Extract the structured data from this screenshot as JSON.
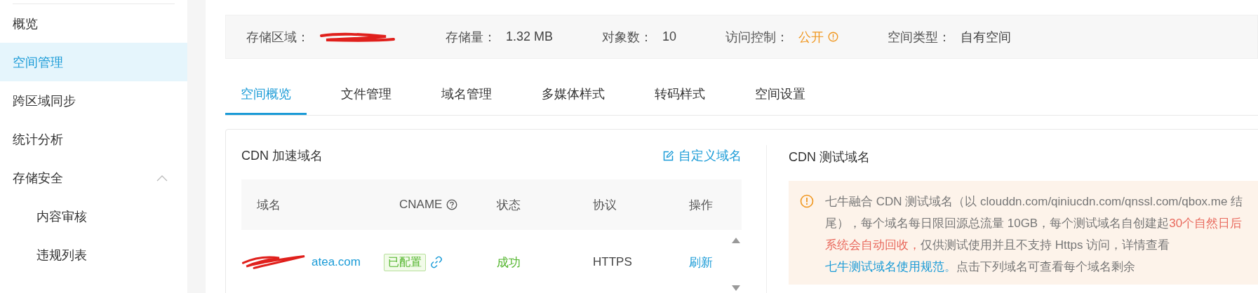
{
  "sidebar": {
    "items": [
      {
        "label": "概览",
        "selected": false
      },
      {
        "label": "空间管理",
        "selected": true
      },
      {
        "label": "跨区域同步",
        "selected": false
      },
      {
        "label": "统计分析",
        "selected": false
      },
      {
        "label": "存储安全",
        "selected": false,
        "expanded": true,
        "children": [
          {
            "label": "内容审核",
            "selected": false
          },
          {
            "label": "违规列表",
            "selected": false
          }
        ]
      }
    ]
  },
  "info_bar": [
    {
      "label": "存储区域：",
      "kind": "redacted"
    },
    {
      "label": "存储量：",
      "value": "1.32 MB",
      "kind": "plain"
    },
    {
      "label": "对象数：",
      "value": "10",
      "kind": "plain"
    },
    {
      "label": "访问控制：",
      "value": "公开",
      "kind": "warning"
    },
    {
      "label": "空间类型：",
      "value": "自有空间",
      "kind": "plain"
    }
  ],
  "tabs": [
    {
      "label": "空间概览",
      "selected": true
    },
    {
      "label": "文件管理",
      "selected": false
    },
    {
      "label": "域名管理",
      "selected": false
    },
    {
      "label": "多媒体样式",
      "selected": false
    },
    {
      "label": "转码样式",
      "selected": false
    },
    {
      "label": "空间设置",
      "selected": false
    }
  ],
  "cdn_domains": {
    "title": "CDN 加速域名",
    "action": "自定义域名",
    "table": {
      "columns": [
        {
          "label": "域名",
          "help": false
        },
        {
          "label": "CNAME",
          "help": true
        },
        {
          "label": "状态",
          "help": false
        },
        {
          "label": "协议",
          "help": false
        },
        {
          "label": "操作",
          "help": false
        }
      ],
      "rows": [
        {
          "domain": "atea.com",
          "redacted": true,
          "cname": "已配置",
          "status": "成功",
          "protocol": "HTTPS",
          "action": "刷新"
        }
      ]
    }
  },
  "test_domains": {
    "title": "CDN 测试域名",
    "notice": [
      {
        "text": "七牛融合 CDN 测试域名（以 clouddn.com/qiniucdn.com/qnssl.com/qbox.me 结尾），每个域名每日限回源总流量 10GB，每个测试域名自创建起",
        "kind": "plain"
      },
      {
        "text": "30个自然日后系统会自动回收，",
        "kind": "alert"
      },
      {
        "text": "仅供测试使用并且不支持 Https 访问，详情查看",
        "kind": "plain"
      },
      {
        "text": "七牛测试域名使用规范。",
        "kind": "link"
      },
      {
        "text": "点击下列域名可查看每个域名剩余",
        "kind": "plain"
      }
    ]
  }
}
